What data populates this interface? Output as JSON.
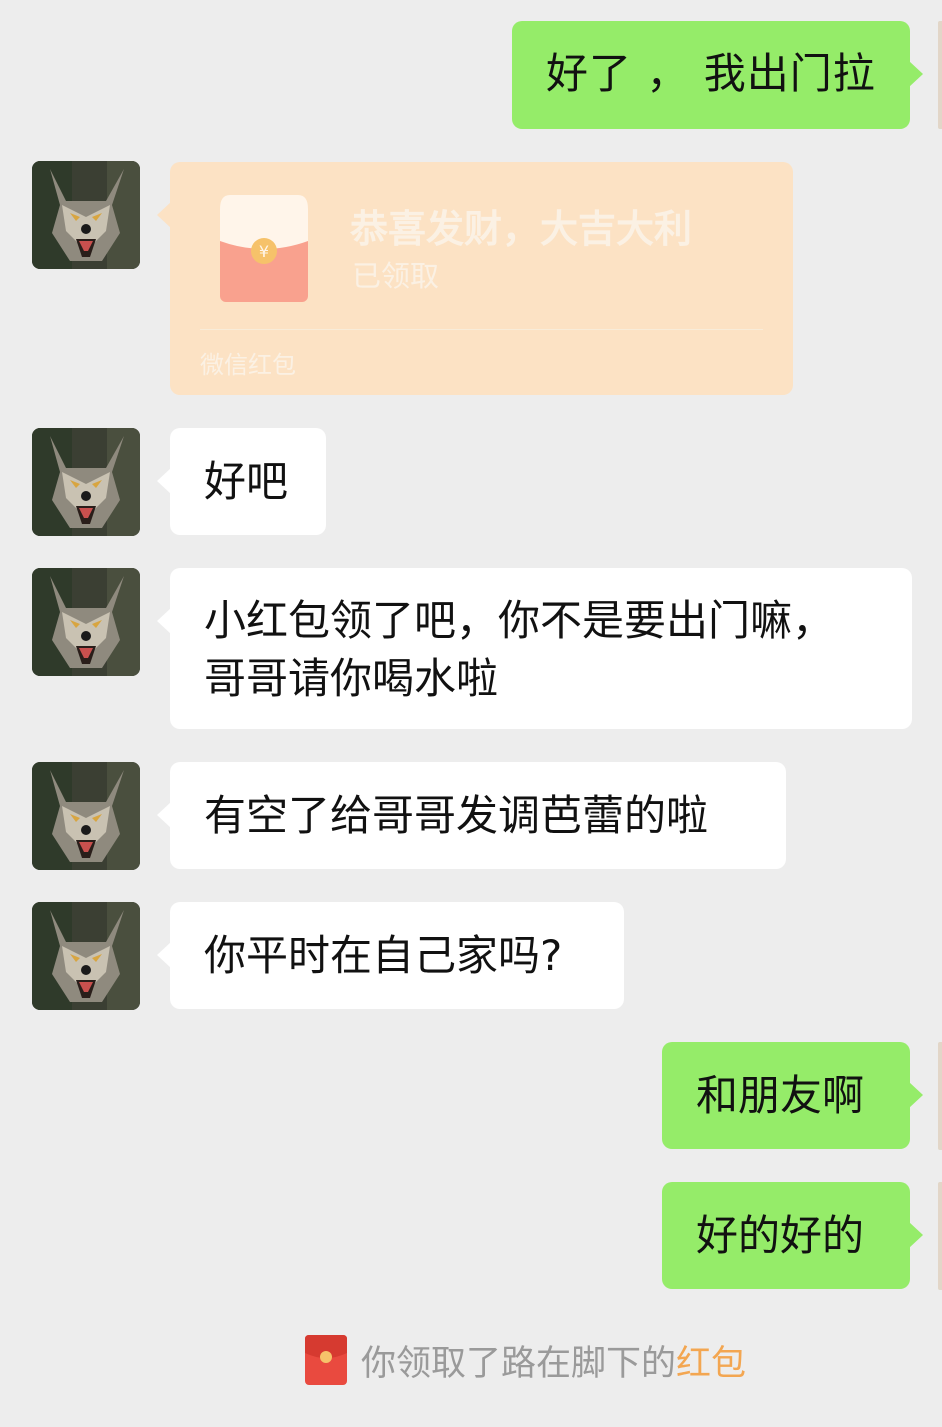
{
  "colors": {
    "background": "#ededed",
    "incoming_bubble": "#ffffff",
    "outgoing_bubble": "#95ec69",
    "red_packet_bg": "#fce2c4",
    "red_packet_text": "#fbf1e4",
    "system_highlight": "#f3a651"
  },
  "messages": [
    {
      "side": "out",
      "text": "好了 ， 我出门拉"
    },
    {
      "side": "in",
      "type": "red_packet",
      "greeting": "恭喜发财，大吉大利",
      "status": "已领取",
      "footer": "微信红包",
      "icon": "red-envelope-icon"
    },
    {
      "side": "in",
      "text": "好吧"
    },
    {
      "side": "in",
      "line1": "小红包领了吧，你不是要出门嘛，",
      "line2": "哥哥请你喝水啦"
    },
    {
      "side": "in",
      "text": "有空了给哥哥发调芭蕾的啦"
    },
    {
      "side": "in",
      "text": "你平时在自己家吗?"
    },
    {
      "side": "out",
      "text": "和朋友啊"
    },
    {
      "side": "out",
      "text": "好的好的"
    }
  ],
  "system_notice": {
    "icon": "red-packet-icon",
    "prefix": "你领取了路在脚下的",
    "highlight": "红包"
  },
  "avatar_icon": "wolf-avatar-icon"
}
